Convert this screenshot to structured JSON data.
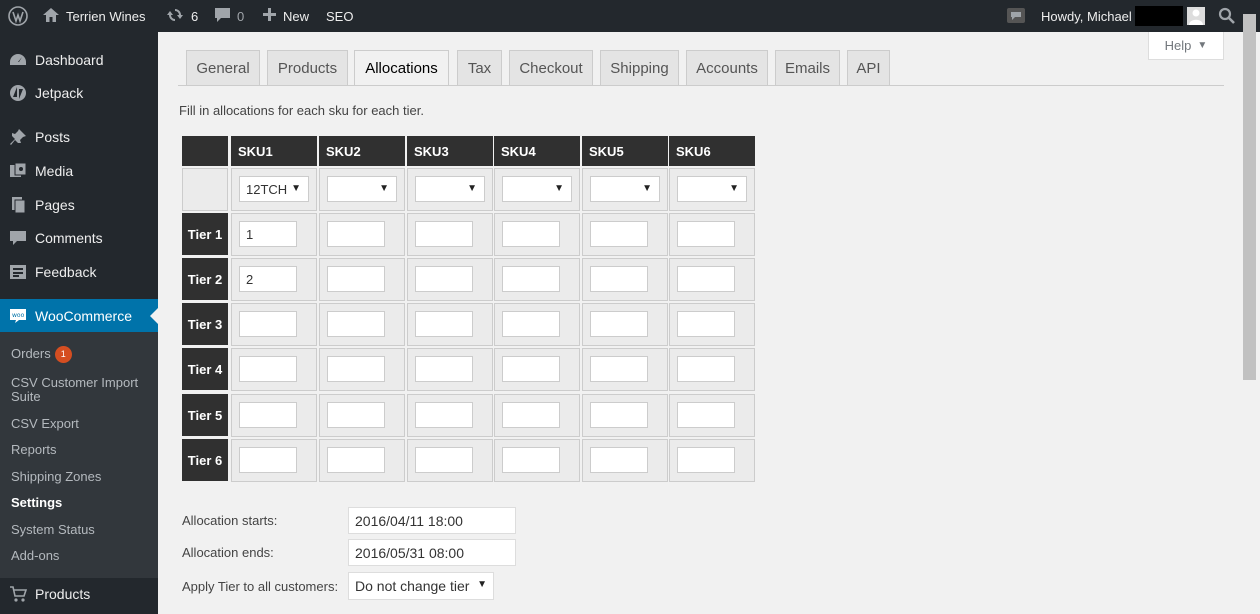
{
  "adminbar": {
    "site_name": "Terrien Wines",
    "updates_count": "6",
    "comments_count": "0",
    "new_label": "New",
    "seo_label": "SEO",
    "howdy": "Howdy, Michael"
  },
  "sidebar": {
    "items": [
      {
        "label": "Dashboard",
        "icon": "dashboard-icon"
      },
      {
        "label": "Jetpack",
        "icon": "jetpack-icon"
      },
      {
        "label": "Posts",
        "icon": "pin-icon"
      },
      {
        "label": "Media",
        "icon": "media-icon"
      },
      {
        "label": "Pages",
        "icon": "pages-icon"
      },
      {
        "label": "Comments",
        "icon": "comment-icon"
      },
      {
        "label": "Feedback",
        "icon": "feedback-icon"
      },
      {
        "label": "WooCommerce",
        "icon": "woo-icon"
      },
      {
        "label": "Products",
        "icon": "cart-icon"
      }
    ],
    "submenu": {
      "orders": "Orders",
      "orders_badge": "1",
      "csv_import_line1": "CSV Customer Import",
      "csv_import_line2": "Suite",
      "csv_export": "CSV Export",
      "reports": "Reports",
      "shipping_zones": "Shipping Zones",
      "settings": "Settings",
      "system_status": "System Status",
      "addons": "Add-ons"
    }
  },
  "help_label": "Help",
  "tabs": [
    "General",
    "Products",
    "Allocations",
    "Tax",
    "Checkout",
    "Shipping",
    "Accounts",
    "Emails",
    "API"
  ],
  "active_tab": "Allocations",
  "description": "Fill in allocations for each sku for each tier.",
  "grid": {
    "skus": [
      "SKU1",
      "SKU2",
      "SKU3",
      "SKU4",
      "SKU5",
      "SKU6"
    ],
    "sku_selected": [
      "12TCH",
      "",
      "",
      "",
      "",
      ""
    ],
    "tiers": [
      "Tier 1",
      "Tier 2",
      "Tier 3",
      "Tier 4",
      "Tier 5",
      "Tier 6"
    ],
    "values": [
      [
        "1",
        "",
        "",
        "",
        "",
        ""
      ],
      [
        "2",
        "",
        "",
        "",
        "",
        ""
      ],
      [
        "",
        "",
        "",
        "",
        "",
        ""
      ],
      [
        "",
        "",
        "",
        "",
        "",
        ""
      ],
      [
        "",
        "",
        "",
        "",
        "",
        ""
      ],
      [
        "",
        "",
        "",
        "",
        "",
        ""
      ]
    ]
  },
  "form": {
    "starts_label": "Allocation starts:",
    "starts_value": "2016/04/11 18:00",
    "ends_label": "Allocation ends:",
    "ends_value": "2016/05/31 08:00",
    "apply_label": "Apply Tier to all customers:",
    "apply_value": "Do not change tier"
  },
  "colors": {
    "sidebar_bg": "#23282d",
    "active_menu": "#0073aa",
    "header_cell": "#303030",
    "badge": "#d54e21"
  }
}
